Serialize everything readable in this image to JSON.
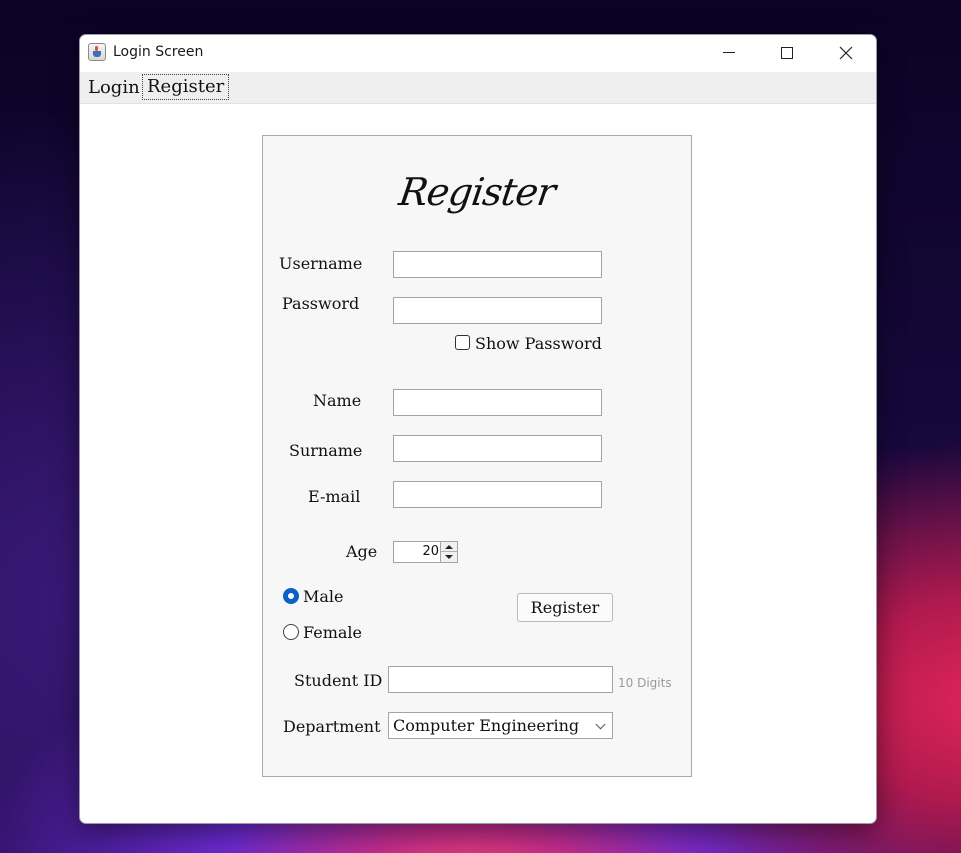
{
  "window": {
    "title": "Login Screen"
  },
  "menubar": {
    "items": [
      {
        "label": "Login"
      },
      {
        "label": "Register"
      }
    ]
  },
  "form": {
    "heading": "Register",
    "username": {
      "label": "Username",
      "value": ""
    },
    "password": {
      "label": "Password",
      "value": ""
    },
    "show_password": {
      "label": "Show Password",
      "checked": false
    },
    "name": {
      "label": "Name",
      "value": ""
    },
    "surname": {
      "label": "Surname",
      "value": ""
    },
    "email": {
      "label": "E-mail",
      "value": ""
    },
    "age": {
      "label": "Age",
      "value": "20"
    },
    "gender": {
      "options": [
        {
          "label": "Male",
          "selected": true
        },
        {
          "label": "Female",
          "selected": false
        }
      ]
    },
    "register_button": "Register",
    "student_id": {
      "label": "Student ID",
      "value": "",
      "hint": "10 Digits"
    },
    "department": {
      "label": "Department",
      "value": "Computer Engineering"
    }
  },
  "colors": {
    "radio_selected": "#0a62c4",
    "panel_bg": "#f7f7f7",
    "hint_text": "#9a9a9a"
  }
}
